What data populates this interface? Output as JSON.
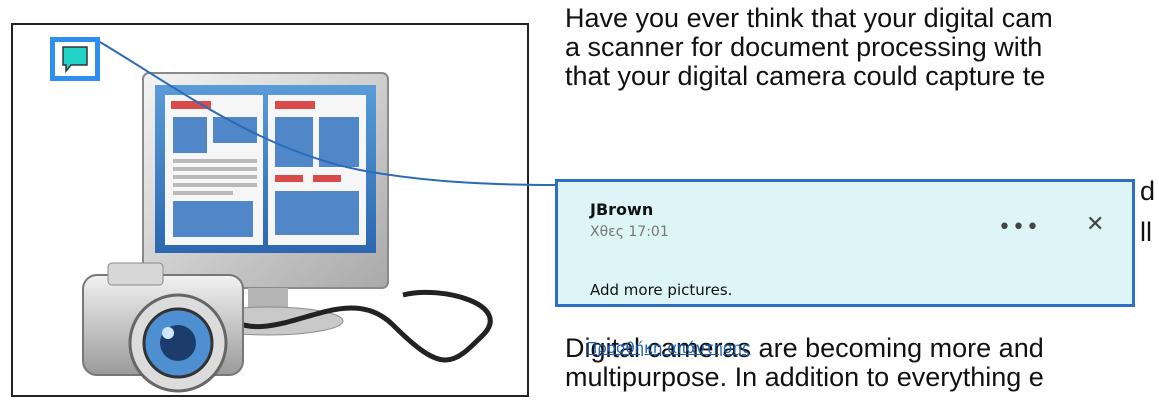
{
  "document": {
    "paragraph1": [
      "Have you ever think that your digital cam",
      "a scanner for document processing with",
      "that your digital camera could capture te"
    ],
    "paragraph2": [
      "d",
      "ll"
    ],
    "paragraph3": [
      "Digital cameras are becoming more and",
      "multipurpose. In addition to everything e"
    ]
  },
  "comment": {
    "author": "JBrown",
    "timestamp": "Χθες 17:01",
    "body": "Add more pictures.",
    "reply_link": "Προσθήκη απάντησης",
    "more_label": "•••",
    "close_label": "✕"
  },
  "icons": {
    "comment_marker": "comment-bubble-icon",
    "more": "more-options-icon",
    "close": "close-icon"
  },
  "colors": {
    "comment_background": "#def5f7",
    "comment_border": "#2d6fc4",
    "marker_border": "#2f8ff0",
    "marker_fill": "#22d3c8",
    "connector_line": "#2a6bb8",
    "reply_link": "#1a5fb4"
  }
}
